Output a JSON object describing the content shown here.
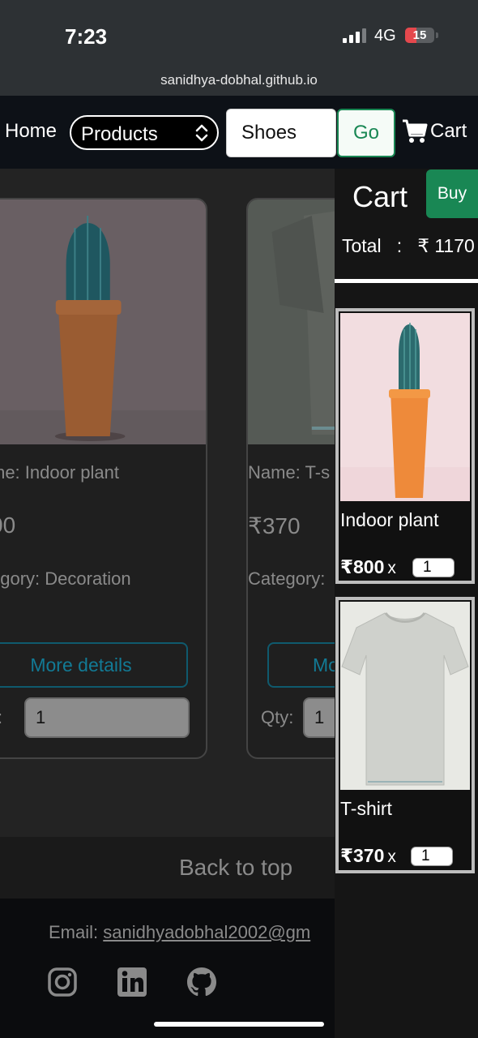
{
  "status_bar": {
    "time": "7:23",
    "network": "4G",
    "battery": "15"
  },
  "browser": {
    "url": "sanidhya-dobhal.github.io"
  },
  "navbar": {
    "home_label": "Home",
    "category_select": "Products",
    "search_value": "Shoes",
    "go_label": "Go",
    "cart_label": "Cart"
  },
  "products": [
    {
      "name": "me: Indoor plant",
      "price": "00",
      "category": "egory: Decoration",
      "more_label": "More details",
      "qty_label": "y:",
      "qty": "1"
    },
    {
      "name": "Name: T-s",
      "price": "₹370",
      "category": "Category:",
      "more_label": "Mo",
      "qty_label": "Qty:",
      "qty": "1"
    }
  ],
  "back_to_top": "Back to top",
  "footer": {
    "email_label": "Email:",
    "email": "sanidhyadobhal2002@gm",
    "social_icons": [
      "instagram-icon",
      "linkedin-icon",
      "github-icon"
    ]
  },
  "cart": {
    "title": "Cart",
    "buy_label": "Buy",
    "total_label": "Total",
    "total_sep": ":",
    "total_value": "₹ 1170",
    "items": [
      {
        "name": "Indoor plant",
        "price": "₹800",
        "times": "x",
        "qty": "1"
      },
      {
        "name": "T-shirt",
        "price": "₹370",
        "times": "x",
        "qty": "1"
      }
    ]
  },
  "colors": {
    "accent_green": "#198754",
    "info": "#127a95",
    "battery_low": "#e5484d"
  }
}
